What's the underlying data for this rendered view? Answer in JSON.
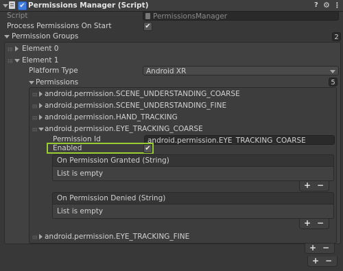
{
  "header": {
    "title": "Permissions Manager (Script)",
    "enabled": "✔",
    "help_icon": "?",
    "settings_icon": "⚙",
    "menu_icon": "⋮"
  },
  "script_row": {
    "label": "Script",
    "value": "PermissionsManager"
  },
  "process_on_start": {
    "label": "Process Permissions On Start",
    "check": "✔"
  },
  "permission_groups": {
    "label": "Permission Groups",
    "count": "2",
    "element0": {
      "label": "Element 0"
    },
    "element1": {
      "label": "Element 1",
      "platform_type": {
        "label": "Platform Type",
        "value": "Android XR"
      },
      "permissions": {
        "label": "Permissions",
        "count": "5",
        "items": [
          "android.permission.SCENE_UNDERSTANDING_COARSE",
          "android.permission.SCENE_UNDERSTANDING_FINE",
          "android.permission.HAND_TRACKING",
          "android.permission.EYE_TRACKING_COARSE",
          "android.permission.EYE_TRACKING_FINE"
        ],
        "expanded": {
          "permission_id": {
            "label": "Permission Id",
            "value": "android.permission.EYE_TRACKING_COARSE"
          },
          "enabled": {
            "label": "Enabled",
            "check": "✔"
          },
          "granted": {
            "title": "On Permission Granted (String)",
            "empty": "List is empty"
          },
          "denied": {
            "title": "On Permission Denied (String)",
            "empty": "List is empty"
          }
        }
      }
    }
  },
  "buttons": {
    "plus": "+",
    "minus": "−"
  },
  "colors": {
    "highlight": "#9acd32",
    "background": "#383838"
  }
}
